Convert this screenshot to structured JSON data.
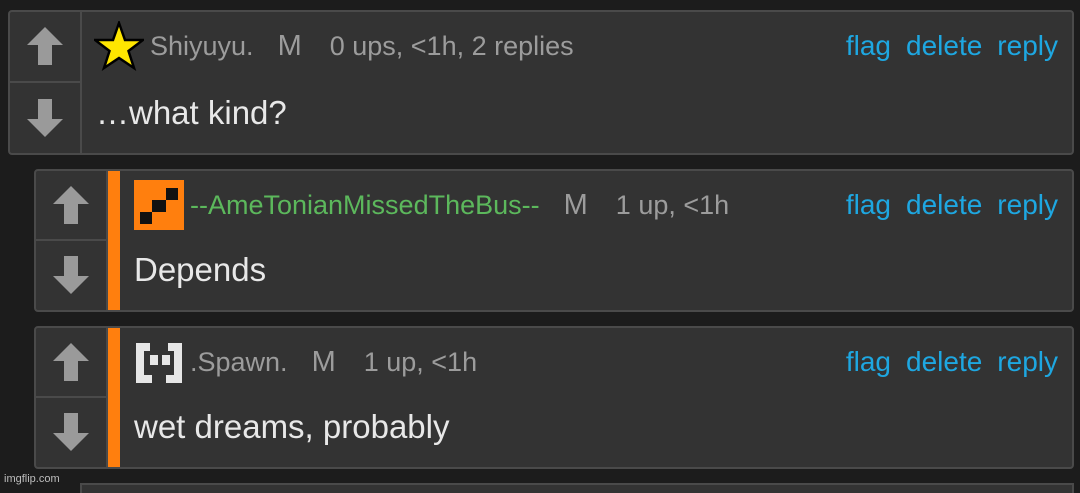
{
  "comments": [
    {
      "username": "Shiyuyu.",
      "avatar_icon": "yellow-star-icon",
      "mod_label": "M",
      "meta": "0 ups, <1h, 2 replies",
      "text": "…what kind?",
      "actions": {
        "flag": "flag",
        "delete": "delete",
        "reply": "reply"
      }
    },
    {
      "username": "--AmeTonianMissedTheBus--",
      "username_color": "#5cb85c",
      "avatar_icon": "orange-square-avatar-icon",
      "mod_label": "M",
      "meta": "1 up, <1h",
      "text": "Depends",
      "actions": {
        "flag": "flag",
        "delete": "delete",
        "reply": "reply"
      }
    },
    {
      "username": ".Spawn.",
      "avatar_icon": "pixel-face-avatar-icon",
      "mod_label": "M",
      "meta": "1 up, <1h",
      "text": "wet dreams, probably",
      "actions": {
        "flag": "flag",
        "delete": "delete",
        "reply": "reply"
      }
    }
  ],
  "colors": {
    "accent": "#ff7f0e",
    "link": "#1ea7e1",
    "background": "#1c1c1c"
  },
  "watermark": "imgflip.com"
}
